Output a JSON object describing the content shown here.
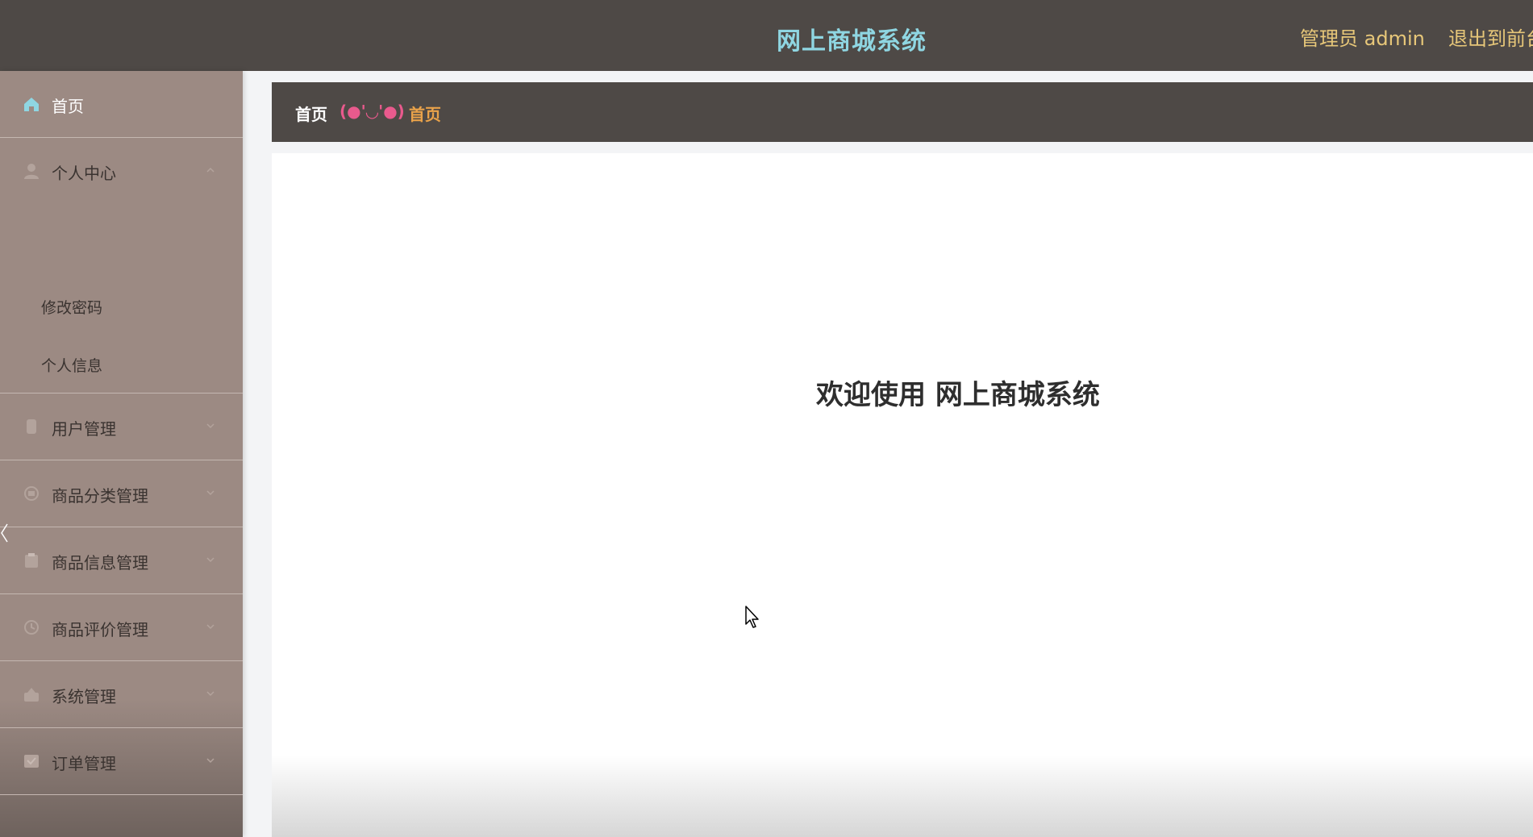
{
  "header": {
    "title": "网上商城系统",
    "admin_label": "管理员 admin",
    "exit_label": "退出到前台"
  },
  "sidebar": {
    "home": {
      "label": "首页",
      "icon": "home-icon"
    },
    "personal_center": {
      "label": "个人中心",
      "icon": "user-icon",
      "expanded": true,
      "children": [
        {
          "label": "修改密码"
        },
        {
          "label": "个人信息"
        }
      ]
    },
    "items": [
      {
        "label": "用户管理",
        "icon": "users-icon"
      },
      {
        "label": "商品分类管理",
        "icon": "category-icon"
      },
      {
        "label": "商品信息管理",
        "icon": "product-icon"
      },
      {
        "label": "商品评价管理",
        "icon": "review-icon"
      },
      {
        "label": "系统管理",
        "icon": "system-icon"
      },
      {
        "label": "订单管理",
        "icon": "order-icon"
      }
    ]
  },
  "breadcrumb": {
    "home": "首页",
    "separator": "(●'◡'●)",
    "current": "首页"
  },
  "main": {
    "welcome": "欢迎使用 网上商城系统"
  },
  "colors": {
    "topbar_bg": "#4e4946",
    "sidebar_bg": "#9c8a83",
    "title": "#8fd6e2",
    "admin_text": "#e7c779",
    "crumb_separator": "#e95a8d",
    "crumb_current": "#e9a24a"
  }
}
